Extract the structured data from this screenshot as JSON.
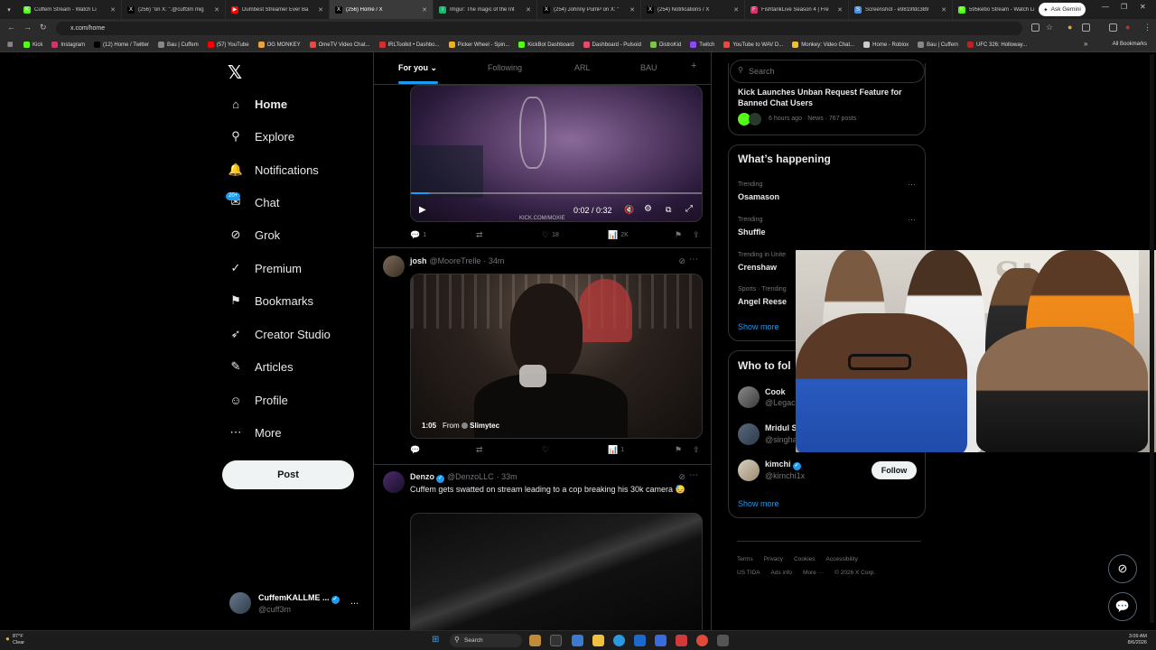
{
  "browser": {
    "tabs": [
      {
        "label": "Cuffem Stream - Watch Li",
        "color": "#53fc18",
        "glyph": "K"
      },
      {
        "label": "(256) \"on X: \".@cuff3m mig",
        "color": "#000000",
        "glyph": "X"
      },
      {
        "label": "Dumbest Streamer Ever Ba",
        "color": "#ff0000",
        "glyph": "▶"
      },
      {
        "label": "(256) Home / X",
        "color": "#000000",
        "glyph": "X",
        "active": true
      },
      {
        "label": "Imgur: The magic of the Int",
        "color": "#1bb76e",
        "glyph": "i"
      },
      {
        "label": "(254) Johnny PumP on X: \"",
        "color": "#000000",
        "glyph": "X"
      },
      {
        "label": "(254) Notifications / X",
        "color": "#000000",
        "glyph": "X"
      },
      {
        "label": "FishtankLive Season 4 | Fre",
        "color": "#d6336c",
        "glyph": "F"
      },
      {
        "label": "Screenshot - e9819fdc389",
        "color": "#4a90d9",
        "glyph": "S"
      },
      {
        "label": "595kebo Stream - Watch Li",
        "color": "#53fc18",
        "glyph": "K"
      }
    ],
    "new_tab": "+",
    "ask_gemini": "Ask Gemini",
    "url": "x.com/home",
    "bookmarks": [
      {
        "label": "Kick",
        "color": "#53fc18"
      },
      {
        "label": "Instagram",
        "color": "#d6336c"
      },
      {
        "label": "(12) Home / Twitter",
        "color": "#000000"
      },
      {
        "label": "Bau | Cuffem",
        "color": "#888888"
      },
      {
        "label": "(57) YouTube",
        "color": "#ff0000"
      },
      {
        "label": "OG MONKEY",
        "color": "#e8a33d"
      },
      {
        "label": "OmeTV Video Chat...",
        "color": "#e84a3d"
      },
      {
        "label": "IRLToolkit • Dashbo...",
        "color": "#d03030"
      },
      {
        "label": "Picker Wheel - Spin...",
        "color": "#f0b020"
      },
      {
        "label": "KickBot Dashboard",
        "color": "#53fc18"
      },
      {
        "label": "Dashboard - Pulsoid",
        "color": "#e84a6a"
      },
      {
        "label": "DistroKid",
        "color": "#7cc44a"
      },
      {
        "label": "Twitch",
        "color": "#9146ff"
      },
      {
        "label": "YouTube to WAV D...",
        "color": "#e84a3d"
      },
      {
        "label": "Monkey: Video Chat...",
        "color": "#f0c030"
      },
      {
        "label": "Home - Roblox",
        "color": "#cccccc"
      },
      {
        "label": "Bau | Cuffem",
        "color": "#888888"
      },
      {
        "label": "UFC 326: Holloway...",
        "color": "#c02020"
      }
    ],
    "all_bookmarks": "All Bookmarks"
  },
  "sidebar": {
    "logo": "𝕏",
    "items": [
      {
        "label": "Home",
        "icon": "house-icon",
        "glyph": "⌂"
      },
      {
        "label": "Explore",
        "icon": "search-icon",
        "glyph": "⚲"
      },
      {
        "label": "Notifications",
        "icon": "bell-icon",
        "glyph": "🔔"
      },
      {
        "label": "Chat",
        "icon": "chat-icon",
        "glyph": "✉"
      },
      {
        "label": "Grok",
        "icon": "grok-icon",
        "glyph": "⊘"
      },
      {
        "label": "Premium",
        "icon": "premium-icon",
        "glyph": "✓"
      },
      {
        "label": "Bookmarks",
        "icon": "bookmark-icon",
        "glyph": "⚑"
      },
      {
        "label": "Creator Studio",
        "icon": "rocket-icon",
        "glyph": "➶"
      },
      {
        "label": "Articles",
        "icon": "article-icon",
        "glyph": "✎"
      },
      {
        "label": "Profile",
        "icon": "person-icon",
        "glyph": "☺"
      },
      {
        "label": "More",
        "icon": "more-circle-icon",
        "glyph": "⋯"
      }
    ],
    "chat_badge": "20+",
    "post_button": "Post",
    "account": {
      "name": "CuffemKALLME ...",
      "handle": "@cuff3m",
      "more": "..."
    }
  },
  "feed": {
    "tabs": [
      "For you",
      "Following",
      "ARL",
      "BAU"
    ],
    "add_tab": "+",
    "post1": {
      "video_time": "0:02 / 0:32",
      "watermark": "KICK.COM/MOXIE",
      "replies": "1",
      "reposts": "",
      "likes": "18",
      "views": "2K"
    },
    "post2": {
      "name": "josh",
      "handle": "@MooreTrelle",
      "time": "· 34m",
      "duration": "1:05",
      "from_label": "From",
      "from_account": "Slimytec",
      "replies": "",
      "reposts": "",
      "likes": "",
      "views": "1"
    },
    "post3": {
      "name": "Denzo",
      "handle": "@DenzoLLC",
      "time": "· 33m",
      "text": "Cuffem gets swatted on stream leading to a cop breaking his 30k camera",
      "emoji": "😓"
    }
  },
  "right": {
    "search_placeholder": "Search",
    "news": {
      "title": "Kick Launches Unban Request Feature for Banned Chat Users",
      "meta": "6 hours ago · News · 767 posts"
    },
    "happening": {
      "title": "What’s happening",
      "trends": [
        {
          "category": "Trending",
          "name": "Osamason"
        },
        {
          "category": "Trending",
          "name": "Shuffle"
        },
        {
          "category": "Trending in Unite",
          "name": "Crenshaw"
        },
        {
          "category": "Sports · Trending",
          "name": "Angel Reese"
        }
      ],
      "show_more": "Show more"
    },
    "who_to_follow": {
      "title": "Who to fol",
      "accounts": [
        {
          "name": "Cook",
          "handle": "@Legac"
        },
        {
          "name": "Mridul S",
          "handle": "@singha"
        },
        {
          "name": "kimchi",
          "handle": "@kimchi1x"
        }
      ],
      "follow_button": "Follow",
      "show_more": "Show more"
    },
    "footer": [
      "Terms",
      "Privacy",
      "Cookies",
      "Accessibility",
      "US TIDA",
      "Ads info",
      "More ···",
      "© 2026 X Corp."
    ]
  },
  "taskbar": {
    "weather_temp": "87°F",
    "weather_desc": "Clear",
    "search": "Search",
    "time": "3:09 AM",
    "date": "8/6/2026"
  }
}
